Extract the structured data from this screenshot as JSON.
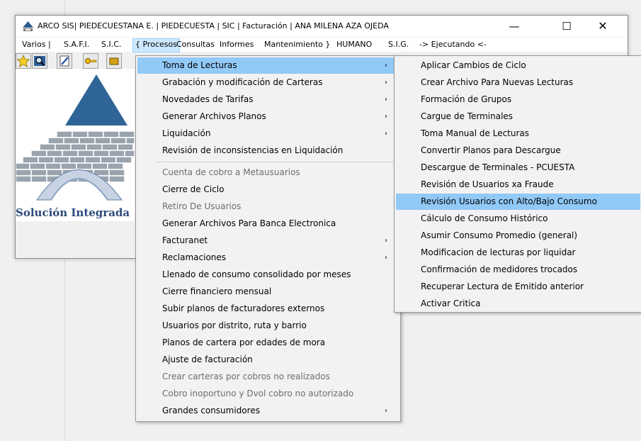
{
  "window": {
    "title": "ARCO SIS| PIEDECUESTANA E. | PIEDECUESTA | SIC | Facturación | ANA MILENA AZA OJEDA",
    "minimize": "—",
    "maximize": "☐",
    "close": "✕",
    "app_icon": "arco-app-icon"
  },
  "menubar": [
    "Varios |",
    "S.A.F.I.",
    "S.I.C.",
    "{ Procesos",
    "Consultas",
    "Informes",
    "Mantenimiento }",
    "HUMANO",
    "S.I.G.",
    "-> Ejecutando <-"
  ],
  "toolbar": [
    "star-icon",
    "search-icon",
    "edit-icon",
    "key-icon",
    "tool-icon"
  ],
  "logo": {
    "text": "Solución Integrada"
  },
  "procesos_menu": [
    {
      "label": "Toma de Lecturas",
      "arrow": "›",
      "state": "highlighted"
    },
    {
      "label": "Grabación y modificación de Carteras",
      "arrow": "›"
    },
    {
      "label": "Novedades de Tarifas",
      "arrow": "›"
    },
    {
      "label": "Generar Archivos Planos",
      "arrow": "›"
    },
    {
      "label": "Liquidación",
      "arrow": "›"
    },
    {
      "label": "Revisión de inconsistencias en Liquidación"
    },
    {
      "label": "Cuenta de cobro a Metausuarios",
      "state": "disabled"
    },
    {
      "label": "Cierre de Ciclo"
    },
    {
      "label": "Retiro De Usuarios",
      "state": "disabled"
    },
    {
      "label": "Generar Archivos Para Banca Electronica"
    },
    {
      "label": "Facturanet",
      "arrow": "›"
    },
    {
      "label": "Reclamaciones",
      "arrow": "›"
    },
    {
      "label": "Llenado de consumo consolidado por meses"
    },
    {
      "label": "Cierre financiero mensual"
    },
    {
      "label": "Subir planos de facturadores externos"
    },
    {
      "label": "Usuarios por distrito, ruta y barrio"
    },
    {
      "label": "Planos de cartera por edades de mora"
    },
    {
      "label": "Ajuste de facturación"
    },
    {
      "label": "Crear carteras por cobros no realizados",
      "state": "disabled"
    },
    {
      "label": "Cobro inoportuno y Dvol cobro no autorizado",
      "state": "disabled"
    },
    {
      "label": "Grandes consumidores",
      "arrow": "›"
    }
  ],
  "toma_lecturas_submenu": [
    {
      "label": "Aplicar Cambios de Ciclo"
    },
    {
      "label": "Crear Archivo Para Nuevas Lecturas"
    },
    {
      "label": "Formación de Grupos"
    },
    {
      "label": "Cargue de Terminales"
    },
    {
      "label": "Toma Manual de Lecturas"
    },
    {
      "label": "Convertir Planos para Descargue"
    },
    {
      "label": "Descargue de Terminales - PCUESTA"
    },
    {
      "label": "Revisión de Usuarios xa Fraude"
    },
    {
      "label": "Revisión Usuarios con Alto/Bajo Consumo",
      "state": "highlighted"
    },
    {
      "label": "Cálculo de  Consumo  Histórico"
    },
    {
      "label": "Asumir Consumo Promedio (general)"
    },
    {
      "label": "Modificacion de lecturas por liquidar"
    },
    {
      "label": "Confirmación de medidores trocados"
    },
    {
      "label": "Recuperar Lectura de Emitido anterior"
    },
    {
      "label": "Activar Critica"
    }
  ],
  "colors": {
    "highlight": "#91c9f7",
    "menu_active": "#cce8ff",
    "disabled_text": "#6d6d6d",
    "logo_blue": "#2c5c8f"
  }
}
